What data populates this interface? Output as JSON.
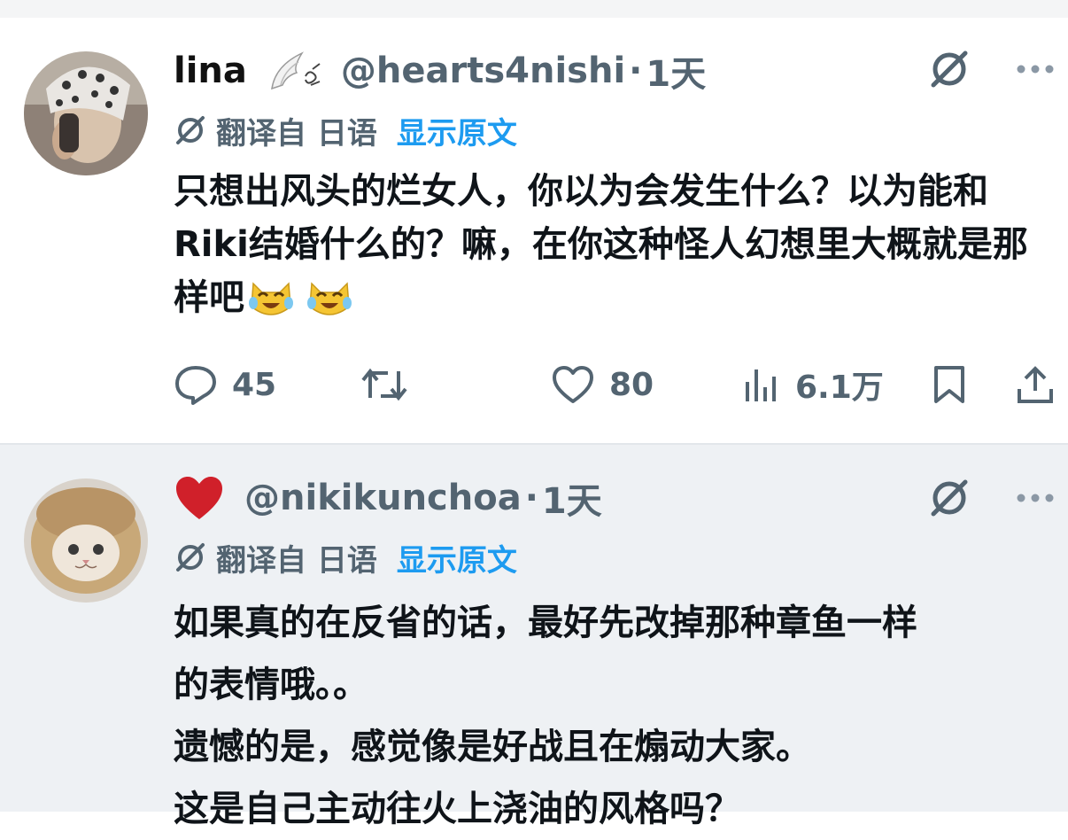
{
  "tweets": [
    {
      "display_name": "lina",
      "handle": "@hearts4nishi",
      "separator": "·",
      "time": "1天",
      "translated_from": "翻译自 日语",
      "show_original": "显示原文",
      "body": "只想出风头的烂女人，你以为会发生什么？以为能和Riki结婚什么的？嘛，在你这种怪人幻想里大概就是那样吧",
      "emojis": [
        "cat-tears-of-joy",
        "cat-tears-of-joy"
      ],
      "stats": {
        "replies": "45",
        "likes": "80",
        "views": "6.1万"
      }
    },
    {
      "display_name": "",
      "handle": "@nikikunchoa",
      "separator": "·",
      "time": "1天",
      "translated_from": "翻译自 日语",
      "show_original": "显示原文",
      "body_lines": [
        "如果真的在反省的话，最好先改掉那种章鱼一样",
        "的表情哦。。",
        "遗憾的是，感觉像是好战且在煽动大家。",
        "这是自己主动往火上浇油的风格吗？"
      ]
    }
  ],
  "colors": {
    "accent": "#1d9bf0",
    "muted": "#536471",
    "text": "#0f1419",
    "heart": "#d0202a"
  },
  "icons": [
    "grok-icon",
    "more-icon",
    "translate-icon",
    "reply-icon",
    "repost-icon",
    "like-icon",
    "views-icon",
    "bookmark-icon",
    "share-icon",
    "angel-wing-icon",
    "red-heart-icon"
  ]
}
